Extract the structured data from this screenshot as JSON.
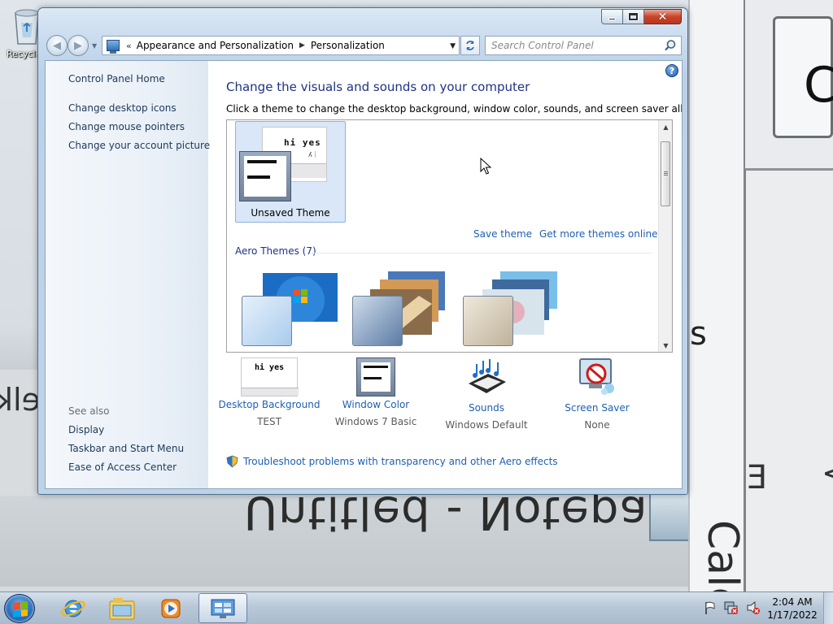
{
  "desktop": {
    "recycle_bin_label": "Recycle Bin",
    "wallpaper_text_notepad": "Untitled - Notepad",
    "wallpaper_text_calc": "Calcu"
  },
  "window": {
    "address": {
      "overflow": "«",
      "crumbs": [
        "Appearance and Personalization",
        "Personalization"
      ]
    },
    "search_placeholder": "Search Control Panel",
    "leftnav": {
      "home": "Control Panel Home",
      "links": [
        "Change desktop icons",
        "Change mouse pointers",
        "Change your account picture"
      ],
      "see_also": "See also",
      "see_also_links": [
        "Display",
        "Taskbar and Start Menu",
        "Ease of Access Center"
      ]
    },
    "main": {
      "title": "Change the visuals and sounds on your computer",
      "subtitle": "Click a theme to change the desktop background, window color, sounds, and screen saver all at once.",
      "selected_theme": "Unsaved Theme",
      "thumb_handwriting": "hi yes",
      "save_theme": "Save theme",
      "more_themes": "Get more themes online",
      "group_header": "Aero Themes (7)",
      "bottom": [
        {
          "label": "Desktop Background",
          "value": "TEST"
        },
        {
          "label": "Window Color",
          "value": "Windows 7 Basic"
        },
        {
          "label": "Sounds",
          "value": "Windows Default"
        },
        {
          "label": "Screen Saver",
          "value": "None"
        }
      ],
      "troubleshoot": "Troubleshoot problems with transparency and other Aero effects"
    }
  },
  "taskbar": {
    "time": "2:04 AM",
    "date": "1/17/2022"
  },
  "colors": {
    "link": "#1e5fb3",
    "title": "#1e3287",
    "selection": "#d9e7f8",
    "close_button": "#c8442a"
  },
  "icons": [
    "recycle-bin-icon",
    "control-panel-icon",
    "search-icon",
    "refresh-icon",
    "help-icon",
    "shield-icon",
    "speaker-muted-icon",
    "flag-icon",
    "network-icon",
    "ie-icon",
    "explorer-icon",
    "media-player-icon"
  ]
}
